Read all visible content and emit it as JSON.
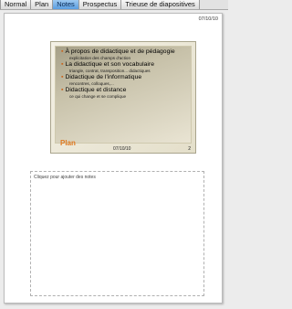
{
  "tabs": [
    "Normal",
    "Plan",
    "Notes",
    "Prospectus",
    "Trieuse de diapositives"
  ],
  "active_tab": "Notes",
  "page": {
    "date": "07/10/10"
  },
  "slide": {
    "items": [
      {
        "text": "À propos de didactique et de pédagogie",
        "sub": [
          "explicitation des champs d'action"
        ]
      },
      {
        "text": "La didactique et son vocabulaire",
        "sub": [
          "triangle, contrat, transposition... didactiques"
        ]
      },
      {
        "text": "Didactique de l'informatique",
        "sub": [
          "rencontres, colloques,..."
        ]
      },
      {
        "text": "Didactique et distance",
        "sub": [
          "ce qui change et se complique"
        ]
      }
    ],
    "title": "Plan",
    "date": "07/10/10",
    "number": "2"
  },
  "notes": {
    "placeholder": "Cliquez pour ajouter des notes"
  },
  "colors": {
    "accent": "#e07a22",
    "active_tab": "#5a9ee0"
  }
}
